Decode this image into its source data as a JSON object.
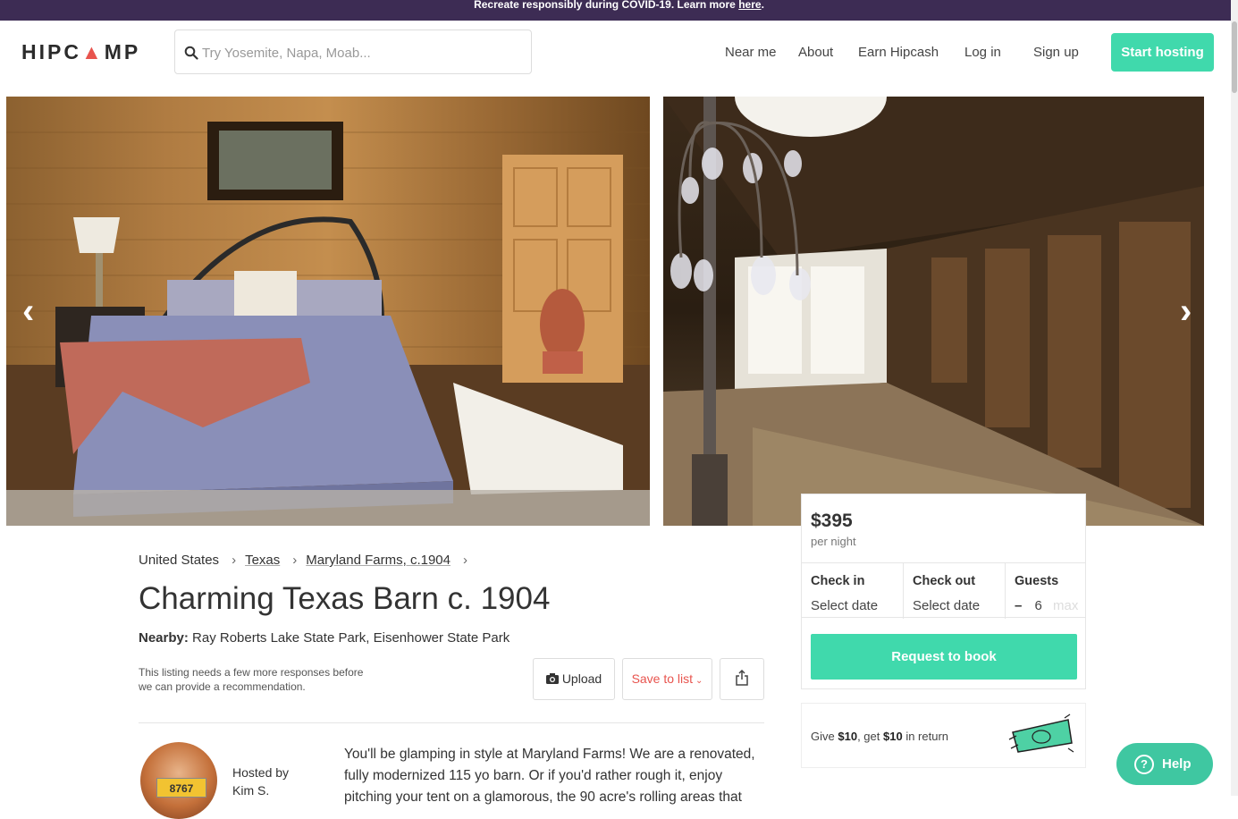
{
  "banner": {
    "text": "Recreate responsibly during COVID-19. Learn more",
    "link": "here",
    "end": "."
  },
  "header": {
    "logo": "HIPCAMP",
    "search_placeholder": "Try Yosemite, Napa, Moab...",
    "nav": [
      "Near me",
      "About",
      "Earn Hipcash",
      "Log in",
      "Sign up"
    ],
    "start_hosting": "Start hosting"
  },
  "gallery": {
    "prev_icon": "chevron-left-icon",
    "next_icon": "chevron-right-icon"
  },
  "breadcrumb": [
    "United States",
    "Texas",
    "Maryland Farms, c.1904"
  ],
  "listing": {
    "title": "Charming Texas Barn c. 1904",
    "nearby_label": "Nearby:",
    "nearby_value": "Ray Roberts Lake State Park, Eisenhower State Park",
    "note": "This listing needs a few more responses before we can provide a recommendation.",
    "upload": "Upload",
    "save_to_list": "Save to list",
    "hosted_by": "Hosted by",
    "host_name": "Kim S.",
    "description": "You'll be glamping in style at Maryland Farms!  We are a renovated, fully modernized 115 yo barn.  Or if you'd rather rough it, enjoy pitching your tent on a glamorous, the 90 acre's rolling areas that"
  },
  "booking": {
    "price": "$395",
    "per_night": "per night",
    "check_in_label": "Check in",
    "check_in_value": "Select date",
    "check_out_label": "Check out",
    "check_out_value": "Select date",
    "guests_label": "Guests",
    "guests_minus": "–",
    "guests_value": "6",
    "guests_max": "max",
    "request_button": "Request to book"
  },
  "referral": {
    "give": "Give",
    "give_amount": "$10",
    "get": "get",
    "get_amount": "$10",
    "suffix": "in return"
  },
  "help": {
    "label": "Help",
    "icon": "?"
  },
  "colors": {
    "accent": "#40d9ac",
    "banner": "#3d2c54",
    "save": "#e8544e"
  }
}
